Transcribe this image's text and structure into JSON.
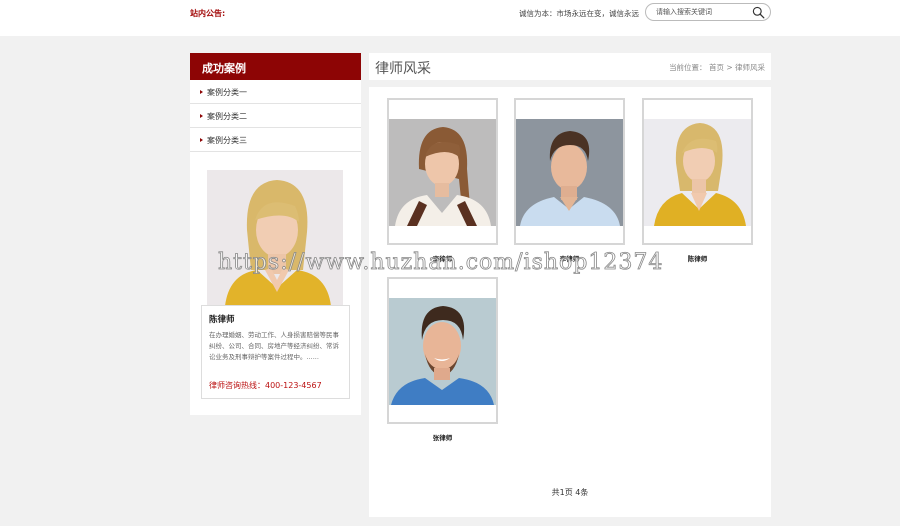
{
  "topbar": {
    "notice_label": "站内公告:",
    "slogan": "诚信为本：市场永远在变，诚信永远",
    "search_placeholder": "请输入搜索关键词",
    "search_icon": "search-icon"
  },
  "sidebar": {
    "title": "成功案例",
    "items": [
      {
        "label": "案例分类一"
      },
      {
        "label": "案例分类二"
      },
      {
        "label": "案例分类三"
      }
    ],
    "featured": {
      "name": "陈律师",
      "description": "在办理婚姻、劳动工作、人身损害赔偿等民事纠纷、公司、合同、房地产等经济纠纷、常诉讼业务及刑事辩护等案件过程中。......",
      "hotline": "律师咨询热线：400-123-4567"
    }
  },
  "main": {
    "title": "律师风采",
    "breadcrumb": "当前位置： 首页 > 律师风采",
    "lawyers": [
      {
        "name": "李律师"
      },
      {
        "name": "李律师"
      },
      {
        "name": "陈律师"
      },
      {
        "name": "张律师"
      }
    ],
    "pager": "共1页 4条"
  },
  "watermark": "https://www.huzhan.com/ishop12374",
  "colors": {
    "brand": "#8d0505",
    "hotline": "#b11111",
    "background": "#f1f1f1"
  }
}
